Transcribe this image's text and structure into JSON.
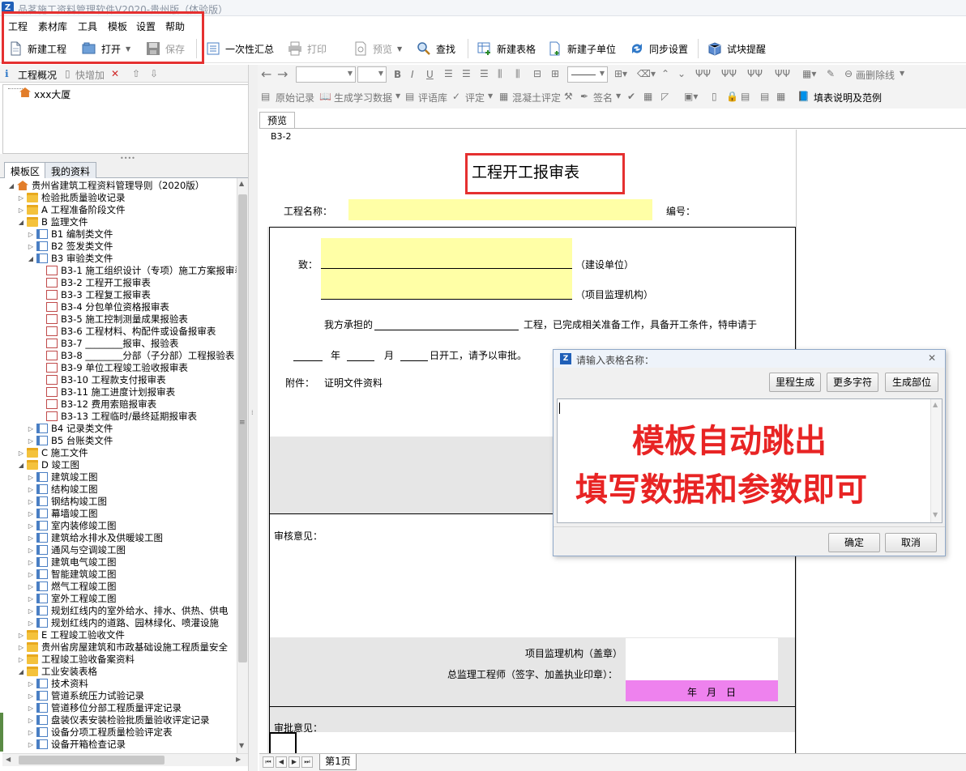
{
  "window": {
    "title": "品茗施工资料管理软件V2020-贵州版（体验版）"
  },
  "menu": [
    "工程",
    "素材库",
    "工具",
    "模板",
    "设置",
    "帮助"
  ],
  "toolbar": {
    "new_project": "新建工程",
    "open": "打开",
    "save": "保存",
    "summary": "一次性汇总",
    "print": "打印",
    "preview": "预览",
    "find": "查找",
    "new_table": "新建表格",
    "new_subunit": "新建子单位",
    "sync_settings": "同步设置",
    "trial_tip": "试块提醒"
  },
  "left_header": {
    "overview": "工程概况",
    "quick_add": "快增加"
  },
  "project_tree": {
    "root": "xxx大厦"
  },
  "left_tabs": [
    "模板区",
    "我的资料"
  ],
  "tree": [
    {
      "level": 0,
      "type": "home",
      "open": true,
      "label": "贵州省建筑工程资料管理导则（2020版）"
    },
    {
      "level": 1,
      "type": "folder",
      "label": "检验批质量验收记录"
    },
    {
      "level": 1,
      "type": "folder",
      "label": "A 工程准备阶段文件"
    },
    {
      "level": 1,
      "type": "folder",
      "open": true,
      "label": "B 监理文件"
    },
    {
      "level": 2,
      "type": "doc",
      "label": "B1 编制类文件"
    },
    {
      "level": 2,
      "type": "doc",
      "label": "B2 签发类文件"
    },
    {
      "level": 2,
      "type": "doc",
      "open": true,
      "label": "B3 审验类文件"
    },
    {
      "level": 3,
      "type": "form",
      "label": "B3-1 施工组织设计（专项）施工方案报审表"
    },
    {
      "level": 3,
      "type": "form",
      "label": "B3-2 工程开工报审表"
    },
    {
      "level": 3,
      "type": "form",
      "label": "B3-3 工程复工报审表"
    },
    {
      "level": 3,
      "type": "form",
      "label": "B3-4 分包单位资格报审表"
    },
    {
      "level": 3,
      "type": "form",
      "label": "B3-5 施工控制测量成果报验表"
    },
    {
      "level": 3,
      "type": "form",
      "label": "B3-6 工程材料、构配件或设备报审表"
    },
    {
      "level": 3,
      "type": "form",
      "label": "B3-7 ________报审、报验表"
    },
    {
      "level": 3,
      "type": "form",
      "label": "B3-8 ________分部（子分部）工程报验表"
    },
    {
      "level": 3,
      "type": "form",
      "label": "B3-9 单位工程竣工验收报审表"
    },
    {
      "level": 3,
      "type": "form",
      "label": "B3-10 工程款支付报审表"
    },
    {
      "level": 3,
      "type": "form",
      "label": "B3-11 施工进度计划报审表"
    },
    {
      "level": 3,
      "type": "form",
      "label": "B3-12 费用索赔报审表"
    },
    {
      "level": 3,
      "type": "form",
      "label": "B3-13 工程临时/最终延期报审表"
    },
    {
      "level": 2,
      "type": "doc",
      "label": "B4 记录类文件"
    },
    {
      "level": 2,
      "type": "doc",
      "label": "B5 台账类文件"
    },
    {
      "level": 1,
      "type": "folder",
      "label": "C 施工文件"
    },
    {
      "level": 1,
      "type": "folder",
      "open": true,
      "label": "D 竣工图"
    },
    {
      "level": 2,
      "type": "doc",
      "label": "建筑竣工图"
    },
    {
      "level": 2,
      "type": "doc",
      "label": "结构竣工图"
    },
    {
      "level": 2,
      "type": "doc",
      "label": "钢结构竣工图"
    },
    {
      "level": 2,
      "type": "doc",
      "label": "幕墙竣工图"
    },
    {
      "level": 2,
      "type": "doc",
      "label": "室内装修竣工图"
    },
    {
      "level": 2,
      "type": "doc",
      "label": "建筑给水排水及供暖竣工图"
    },
    {
      "level": 2,
      "type": "doc",
      "label": "通风与空调竣工图"
    },
    {
      "level": 2,
      "type": "doc",
      "label": "建筑电气竣工图"
    },
    {
      "level": 2,
      "type": "doc",
      "label": "智能建筑竣工图"
    },
    {
      "level": 2,
      "type": "doc",
      "label": "燃气工程竣工图"
    },
    {
      "level": 2,
      "type": "doc",
      "label": "室外工程竣工图"
    },
    {
      "level": 2,
      "type": "doc",
      "label": "规划红线内的室外给水、排水、供热、供电"
    },
    {
      "level": 2,
      "type": "doc",
      "label": "规划红线内的道路、园林绿化、喷灌设施"
    },
    {
      "level": 1,
      "type": "folder",
      "label": "E 工程竣工验收文件"
    },
    {
      "level": 1,
      "type": "folder",
      "label": "贵州省房屋建筑和市政基础设施工程质量安全"
    },
    {
      "level": 1,
      "type": "folder",
      "label": "工程竣工验收备案资料"
    },
    {
      "level": 1,
      "type": "folder",
      "open": true,
      "label": "工业安装表格"
    },
    {
      "level": 2,
      "type": "doc",
      "label": "技术资料"
    },
    {
      "level": 2,
      "type": "doc",
      "label": "管道系统压力试验记录"
    },
    {
      "level": 2,
      "type": "doc",
      "label": "管道移位分部工程质量评定记录"
    },
    {
      "level": 2,
      "type": "doc",
      "label": "盘装仪表安装检验批质量验收评定记录"
    },
    {
      "level": 2,
      "type": "doc",
      "label": "设备分项工程质量检验评定表"
    },
    {
      "level": 2,
      "type": "doc",
      "label": "设备开箱检查记录"
    }
  ],
  "toolbar2": {
    "eraser_label": "画删除线"
  },
  "toolbar3": {
    "original": "原始记录",
    "gen_study": "生成学习数据",
    "comment_lib": "评语库",
    "assess": "评定",
    "concrete": "混凝土评定",
    "sign": "签名",
    "fill_guide": "填表说明及范例"
  },
  "sheet_tab": "预览",
  "form": {
    "code": "B3-2",
    "title": "工程开工报审表",
    "project_name_label": "工程名称：",
    "number_label": "编号：",
    "to_label": "致：",
    "construction_unit": "（建设单位）",
    "supervision_unit": "（项目监理机构）",
    "body1": "我方承担的",
    "body2": "工程，已完成相关准备工作，具备开工条件，特申请于",
    "year": "年",
    "month": "月",
    "day_suffix": "日开工，请予以审批。",
    "attach_label": "附件：",
    "attach_value": "证明文件资料",
    "review_label": "审核意见：",
    "sup_org": "项目监理机构（盖章）",
    "chief_eng": "总监理工程师（签字、加盖执业印章）：",
    "date_line": "年　月　日",
    "approval_label": "审批意见："
  },
  "page_tab": "第1页",
  "dialog": {
    "title": "请输入表格名称：",
    "btn_mileage": "里程生成",
    "btn_more": "更多字符",
    "btn_part": "生成部位",
    "btn_ok": "确定",
    "btn_cancel": "取消"
  },
  "annotation": {
    "line1": "模板自动跳出",
    "line2": "填写数据和参数即可",
    "color": "#e82424"
  }
}
